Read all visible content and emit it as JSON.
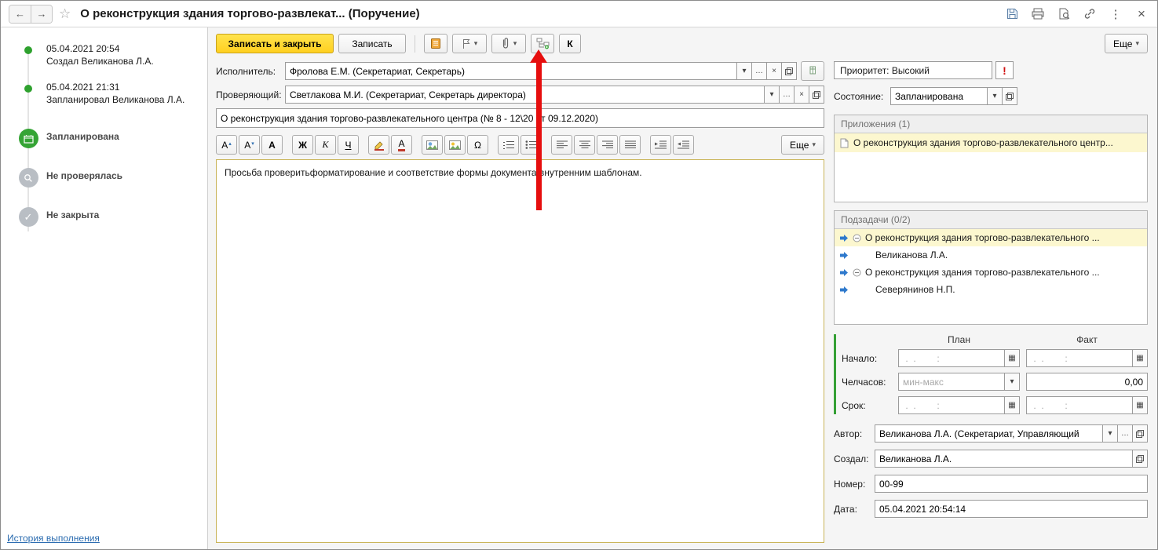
{
  "icons": {
    "back": "←",
    "forward": "→",
    "star": "☆",
    "kebab": "⋮",
    "close": "×",
    "dropdown": "▾",
    "choose": "…",
    "clear": "×",
    "calendar": "▦",
    "check": "✓",
    "omega": "Ω"
  },
  "window": {
    "title": "О реконструкция здания торгово-развлекат... (Поручение)"
  },
  "timeline": {
    "items": [
      {
        "date": "05.04.2021 20:54",
        "text": "Создал Великанова Л.А."
      },
      {
        "date": "05.04.2021 21:31",
        "text": "Запланировал Великанова Л.А."
      }
    ],
    "states": [
      {
        "label": "Запланирована"
      },
      {
        "label": "Не проверялась"
      },
      {
        "label": "Не закрыта"
      }
    ],
    "history_link": "История выполнения"
  },
  "cmdbar": {
    "save_close": "Записать и закрыть",
    "save": "Записать",
    "k_button": "К",
    "more": "Еще"
  },
  "fields": {
    "executor": {
      "label": "Исполнитель:",
      "value": "Фролова Е.М. (Секретариат, Секретарь)"
    },
    "reviewer": {
      "label": "Проверяющий:",
      "value": "Светлакова М.И. (Секретариат, Секретарь директора)"
    },
    "subject": "О реконструкция здания торгово-развлекательного центра (№ 8 - 12\\20 от 09.12.2020)"
  },
  "editor": {
    "buttons": {
      "font_up": "А",
      "font_up_arrow": "▴",
      "font_down": "А",
      "font_down_arrow": "▾",
      "font": "А",
      "bold": "Ж",
      "italic": "К",
      "underline": "Ч",
      "color": "А"
    },
    "more": "Еще",
    "body": "Просьба проверитьформатирование и соответствие формы документа внутренним шаблонам."
  },
  "right": {
    "priority": {
      "text": "Приоритет: Высокий",
      "mark": "!"
    },
    "state": {
      "label": "Состояние:",
      "value": "Запланирована"
    },
    "attachments": {
      "header": "Приложения (1)",
      "items": [
        {
          "text": "О реконструкция здания торгово-развлекательного центр..."
        }
      ]
    },
    "subtasks": {
      "header": "Подзадачи (0/2)",
      "items": [
        {
          "text": "О реконструкция здания торгово-развлекательного ..."
        },
        {
          "text": "Великанова Л.А."
        },
        {
          "text": "О реконструкция здания торгово-развлекательного ..."
        },
        {
          "text": "Северянинов Н.П."
        }
      ]
    },
    "planfact": {
      "plan_header": "План",
      "fact_header": "Факт",
      "start_label": "Начало:",
      "hours_label": "Челчасов:",
      "due_label": "Срок:",
      "empty_datetime": " .  .        :",
      "minmax_placeholder": "мин-макс",
      "hours_fact": "0,00"
    },
    "author": {
      "label": "Автор:",
      "value": "Великанова Л.А. (Секретариат, Управляющий"
    },
    "created": {
      "label": "Создал:",
      "value": "Великанова Л.А."
    },
    "number": {
      "label": "Номер:",
      "value": "00-99"
    },
    "date": {
      "label": "Дата:",
      "value": "05.04.2021 20:54:14"
    }
  }
}
